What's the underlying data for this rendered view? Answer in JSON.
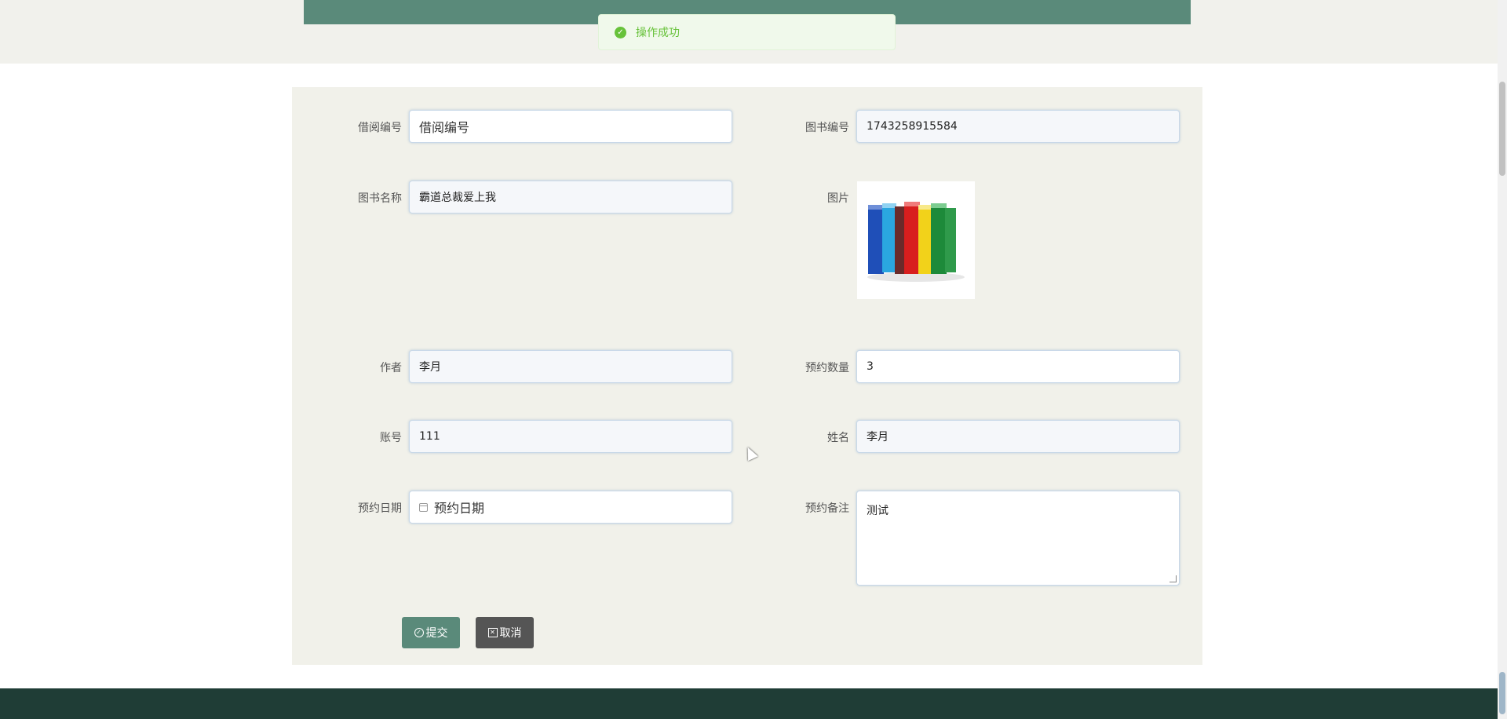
{
  "toast": {
    "message": "操作成功"
  },
  "form": {
    "borrow_no": {
      "label": "借阅编号",
      "placeholder": "借阅编号"
    },
    "book_no": {
      "label": "图书编号",
      "value": "1743258915584"
    },
    "book_name": {
      "label": "图书名称",
      "value": "霸道总裁爱上我"
    },
    "image": {
      "label": "图片"
    },
    "author": {
      "label": "作者",
      "value": "李月"
    },
    "reserve_qty": {
      "label": "预约数量",
      "value": "3"
    },
    "account": {
      "label": "账号",
      "value": "111"
    },
    "name": {
      "label": "姓名",
      "value": "李月"
    },
    "reserve_date": {
      "label": "预约日期",
      "placeholder": "预约日期"
    },
    "reserve_note": {
      "label": "预约备注",
      "value": "测试"
    }
  },
  "actions": {
    "submit": "提交",
    "cancel": "取消"
  },
  "colors": {
    "primary": "#5a8a7a",
    "footer": "#1f3d36",
    "panel": "#f1f1ea",
    "success": "#67c23a"
  }
}
